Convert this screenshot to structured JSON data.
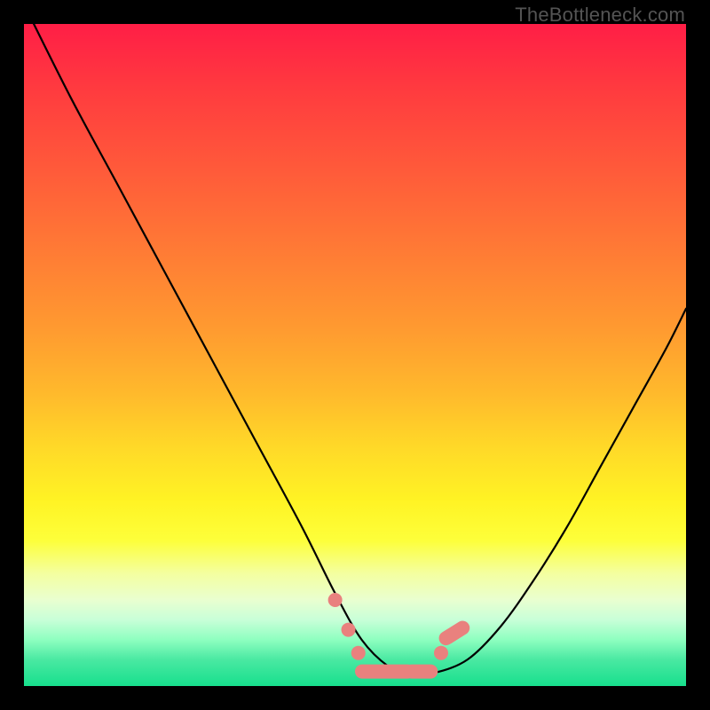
{
  "watermark": "TheBottleneck.com",
  "chart_data": {
    "type": "line",
    "title": "",
    "xlabel": "",
    "ylabel": "",
    "xlim": [
      0,
      100
    ],
    "ylim": [
      0,
      100
    ],
    "grid": false,
    "legend": false,
    "background_gradient": {
      "top_color": "#ff1e46",
      "mid_color": "#ffd928",
      "bottom_color": "#17df8d"
    },
    "series": [
      {
        "name": "bottleneck-curve",
        "x": [
          0,
          7,
          14,
          21,
          28,
          35,
          42,
          47,
          51,
          55,
          58,
          62,
          67,
          72,
          77,
          82,
          87,
          92,
          97,
          100
        ],
        "values": [
          103,
          89,
          76,
          63,
          50,
          37,
          24,
          14,
          7,
          3,
          2,
          2,
          4,
          9,
          16,
          24,
          33,
          42,
          51,
          57
        ]
      }
    ],
    "markers": [
      {
        "x": 47.0,
        "y": 13.0,
        "shape": "dot"
      },
      {
        "x": 49.0,
        "y": 8.5,
        "shape": "dot"
      },
      {
        "x": 50.5,
        "y": 5.0,
        "shape": "dot"
      },
      {
        "x": 63.0,
        "y": 5.0,
        "shape": "dot"
      },
      {
        "x": 65.0,
        "y": 8.0,
        "shape": "pill",
        "angle": 58
      },
      {
        "x": 54.5,
        "y": 2.2,
        "shape": "bar",
        "width": 9
      },
      {
        "x": 60.0,
        "y": 2.2,
        "shape": "bar",
        "width": 5
      }
    ]
  }
}
